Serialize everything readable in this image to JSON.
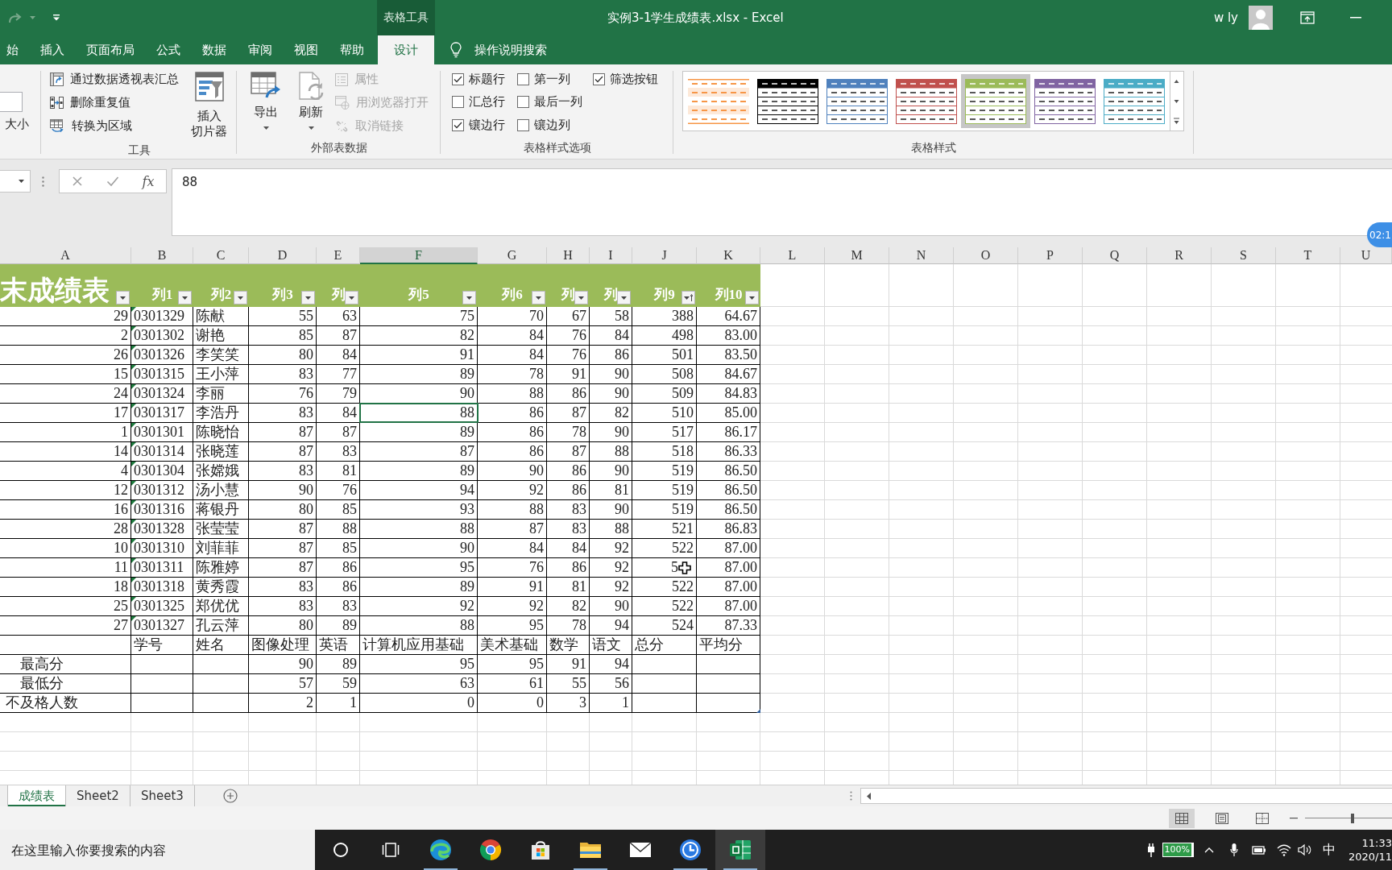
{
  "title_bar": {
    "context_label": "表格工具",
    "title": "实例3-1学生成绩表.xlsx - Excel",
    "user": "w ly"
  },
  "ribbon_tabs": [
    {
      "label": "始",
      "selected": false
    },
    {
      "label": "插入",
      "selected": false
    },
    {
      "label": "页面布局",
      "selected": false
    },
    {
      "label": "公式",
      "selected": false
    },
    {
      "label": "数据",
      "selected": false
    },
    {
      "label": "审阅",
      "selected": false
    },
    {
      "label": "视图",
      "selected": false
    },
    {
      "label": "帮助",
      "selected": false
    },
    {
      "label": "设计",
      "selected": true
    }
  ],
  "tell_me": {
    "label": "操作说明搜索"
  },
  "ribbon": {
    "size_group": {
      "resize_label": "大小"
    },
    "tools_group": {
      "label": "工具",
      "commands": [
        {
          "kind": "pivot",
          "label": "通过数据透视表汇总"
        },
        {
          "kind": "dedupe",
          "label": "删除重复值"
        },
        {
          "kind": "convert",
          "label": "转换为区域"
        }
      ],
      "slicer_lines": [
        "插入",
        "切片器"
      ]
    },
    "external_group": {
      "label": "外部表数据",
      "large_buttons": [
        {
          "kind": "export",
          "label": "导出"
        },
        {
          "kind": "refresh",
          "label": "刷新"
        }
      ],
      "small_buttons": [
        {
          "kind": "properties",
          "label": "属性",
          "disabled": true
        },
        {
          "kind": "browser",
          "label": "用浏览器打开",
          "disabled": true
        },
        {
          "kind": "unlink",
          "label": "取消链接",
          "disabled": true
        }
      ]
    },
    "options_group": {
      "label": "表格样式选项",
      "options": [
        {
          "label": "标题行",
          "checked": true
        },
        {
          "label": "汇总行",
          "checked": false
        },
        {
          "label": "镶边行",
          "checked": true
        },
        {
          "label": "第一列",
          "checked": false
        },
        {
          "label": "最后一列",
          "checked": false
        },
        {
          "label": "镶边列",
          "checked": false
        },
        {
          "label": "筛选按钮",
          "checked": true
        }
      ]
    },
    "styles_group": {
      "label": "表格样式",
      "styles": [
        {
          "kind": "light",
          "color": "#f79646",
          "selected": false
        },
        {
          "kind": "medium",
          "color": "#000000",
          "selected": false
        },
        {
          "kind": "medium",
          "color": "#4f81bd",
          "selected": false
        },
        {
          "kind": "medium",
          "color": "#c0504d",
          "selected": false
        },
        {
          "kind": "medium",
          "color": "#9bbb59",
          "selected": true
        },
        {
          "kind": "medium",
          "color": "#8064a2",
          "selected": false
        },
        {
          "kind": "medium",
          "color": "#4bacc6",
          "selected": false
        }
      ]
    }
  },
  "formula_bar": {
    "function_button": "fx",
    "value": "88"
  },
  "recorder_badge": {
    "label": "02:1"
  },
  "sheet": {
    "columns": [
      {
        "letter": "A",
        "selected": false
      },
      {
        "letter": "B",
        "selected": false
      },
      {
        "letter": "C",
        "selected": false
      },
      {
        "letter": "D",
        "selected": false
      },
      {
        "letter": "E",
        "selected": false
      },
      {
        "letter": "F",
        "selected": true
      },
      {
        "letter": "G",
        "selected": false
      },
      {
        "letter": "H",
        "selected": false
      },
      {
        "letter": "I",
        "selected": false
      },
      {
        "letter": "J",
        "selected": false
      },
      {
        "letter": "K",
        "selected": false
      },
      {
        "letter": "L",
        "selected": false
      },
      {
        "letter": "M",
        "selected": false
      },
      {
        "letter": "N",
        "selected": false
      },
      {
        "letter": "O",
        "selected": false
      },
      {
        "letter": "P",
        "selected": false
      },
      {
        "letter": "Q",
        "selected": false
      },
      {
        "letter": "R",
        "selected": false
      },
      {
        "letter": "S",
        "selected": false
      },
      {
        "letter": "T",
        "selected": false
      },
      {
        "letter": "U",
        "selected": false
      }
    ]
  },
  "table": {
    "headers": [
      {
        "kind": "title",
        "label": "末成绩表",
        "sorted": false
      },
      {
        "kind": "field",
        "label": "列1",
        "sorted": false
      },
      {
        "kind": "field",
        "label": "列2",
        "sorted": false
      },
      {
        "kind": "field",
        "label": "列3",
        "sorted": false
      },
      {
        "kind": "field",
        "label": "列",
        "sorted": false
      },
      {
        "kind": "field",
        "label": "列5",
        "sorted": false
      },
      {
        "kind": "field",
        "label": "列6",
        "sorted": false
      },
      {
        "kind": "field",
        "label": "列",
        "sorted": false
      },
      {
        "kind": "field",
        "label": "列",
        "sorted": false
      },
      {
        "kind": "field",
        "label": "列9",
        "sorted": true
      },
      {
        "kind": "field",
        "label": "列10",
        "sorted": false
      }
    ],
    "rows": [
      {
        "cells": [
          "29",
          "0301329",
          "陈献",
          "55",
          "63",
          "75",
          "70",
          "67",
          "58",
          "388",
          "64.67"
        ],
        "flagged": true,
        "active": false,
        "cursor": false
      },
      {
        "cells": [
          "2",
          "0301302",
          "谢艳",
          "85",
          "87",
          "82",
          "84",
          "76",
          "84",
          "498",
          "83.00"
        ],
        "flagged": true,
        "active": false,
        "cursor": false
      },
      {
        "cells": [
          "26",
          "0301326",
          "李笑笑",
          "80",
          "84",
          "91",
          "84",
          "76",
          "86",
          "501",
          "83.50"
        ],
        "flagged": true,
        "active": false,
        "cursor": false
      },
      {
        "cells": [
          "15",
          "0301315",
          "王小萍",
          "83",
          "77",
          "89",
          "78",
          "91",
          "90",
          "508",
          "84.67"
        ],
        "flagged": true,
        "active": false,
        "cursor": false
      },
      {
        "cells": [
          "24",
          "0301324",
          "李丽",
          "76",
          "79",
          "90",
          "88",
          "86",
          "90",
          "509",
          "84.83"
        ],
        "flagged": true,
        "active": false,
        "cursor": false
      },
      {
        "cells": [
          "17",
          "0301317",
          "李浩丹",
          "83",
          "84",
          "88",
          "86",
          "87",
          "82",
          "510",
          "85.00"
        ],
        "flagged": true,
        "active": true,
        "cursor": false
      },
      {
        "cells": [
          "1",
          "0301301",
          "陈晓怡",
          "87",
          "87",
          "89",
          "86",
          "78",
          "90",
          "517",
          "86.17"
        ],
        "flagged": true,
        "active": false,
        "cursor": false
      },
      {
        "cells": [
          "14",
          "0301314",
          "张晓莲",
          "87",
          "83",
          "87",
          "86",
          "87",
          "88",
          "518",
          "86.33"
        ],
        "flagged": true,
        "active": false,
        "cursor": false
      },
      {
        "cells": [
          "4",
          "0301304",
          "张嫦娥",
          "83",
          "81",
          "89",
          "90",
          "86",
          "90",
          "519",
          "86.50"
        ],
        "flagged": true,
        "active": false,
        "cursor": false
      },
      {
        "cells": [
          "12",
          "0301312",
          "汤小慧",
          "90",
          "76",
          "94",
          "92",
          "86",
          "81",
          "519",
          "86.50"
        ],
        "flagged": true,
        "active": false,
        "cursor": false
      },
      {
        "cells": [
          "16",
          "0301316",
          "蒋银丹",
          "80",
          "85",
          "93",
          "88",
          "83",
          "90",
          "519",
          "86.50"
        ],
        "flagged": true,
        "active": false,
        "cursor": false
      },
      {
        "cells": [
          "28",
          "0301328",
          "张莹莹",
          "87",
          "88",
          "88",
          "87",
          "83",
          "88",
          "521",
          "86.83"
        ],
        "flagged": true,
        "active": false,
        "cursor": false
      },
      {
        "cells": [
          "10",
          "0301310",
          "刘菲菲",
          "87",
          "85",
          "90",
          "84",
          "84",
          "92",
          "522",
          "87.00"
        ],
        "flagged": true,
        "active": false,
        "cursor": false
      },
      {
        "cells": [
          "11",
          "0301311",
          "陈雅婷",
          "87",
          "86",
          "95",
          "76",
          "86",
          "92",
          "5",
          "87.00"
        ],
        "flagged": true,
        "active": false,
        "cursor": true
      },
      {
        "cells": [
          "18",
          "0301318",
          "黄秀霞",
          "83",
          "86",
          "89",
          "91",
          "81",
          "92",
          "522",
          "87.00"
        ],
        "flagged": true,
        "active": false,
        "cursor": false
      },
      {
        "cells": [
          "25",
          "0301325",
          "郑优优",
          "83",
          "83",
          "92",
          "92",
          "82",
          "90",
          "522",
          "87.00"
        ],
        "flagged": true,
        "active": false,
        "cursor": false
      },
      {
        "cells": [
          "27",
          "0301327",
          "孔云萍",
          "80",
          "89",
          "88",
          "95",
          "78",
          "94",
          "524",
          "87.33"
        ],
        "flagged": true,
        "active": false,
        "cursor": false
      }
    ],
    "field_labels": [
      "学号",
      "姓名",
      "图像处理",
      "英语",
      "计算机应用基础",
      "美术基础",
      "数学",
      "语文",
      "总分",
      "平均分"
    ],
    "stats": [
      {
        "label": "最高分",
        "values": [
          "90",
          "89",
          "95",
          "95",
          "91",
          "94"
        ]
      },
      {
        "label": "最低分",
        "values": [
          "57",
          "59",
          "63",
          "61",
          "55",
          "56"
        ]
      },
      {
        "label": "不及格人数",
        "values": [
          "2",
          "1",
          "0",
          "0",
          "3",
          "1"
        ]
      }
    ]
  },
  "sheet_tabs": [
    {
      "label": "成绩表",
      "selected": true
    },
    {
      "label": "Sheet2",
      "selected": false
    },
    {
      "label": "Sheet3",
      "selected": false
    }
  ],
  "status_bar": {
    "views": [
      {
        "kind": "normal",
        "selected": true
      },
      {
        "kind": "page_layout",
        "selected": false
      },
      {
        "kind": "page_break",
        "selected": false
      }
    ],
    "zoom_slider": {
      "level": 0.55
    }
  },
  "taskbar": {
    "search": {
      "placeholder": "在这里输入你要搜索的内容"
    },
    "apps": [
      {
        "kind": "cortana",
        "running": false,
        "active": false
      },
      {
        "kind": "task_view",
        "running": false,
        "active": false
      },
      {
        "kind": "edge",
        "running": true,
        "active": false
      },
      {
        "kind": "chrome",
        "running": false,
        "active": false
      },
      {
        "kind": "store",
        "running": false,
        "active": false
      },
      {
        "kind": "explorer",
        "running": true,
        "active": false
      },
      {
        "kind": "mail",
        "running": false,
        "active": false
      },
      {
        "kind": "clock",
        "running": true,
        "active": false
      },
      {
        "kind": "excel",
        "running": true,
        "active": true
      }
    ],
    "tray": {
      "battery": "100%",
      "input_method": "中",
      "time": "11:33",
      "date": "2020/11"
    }
  }
}
